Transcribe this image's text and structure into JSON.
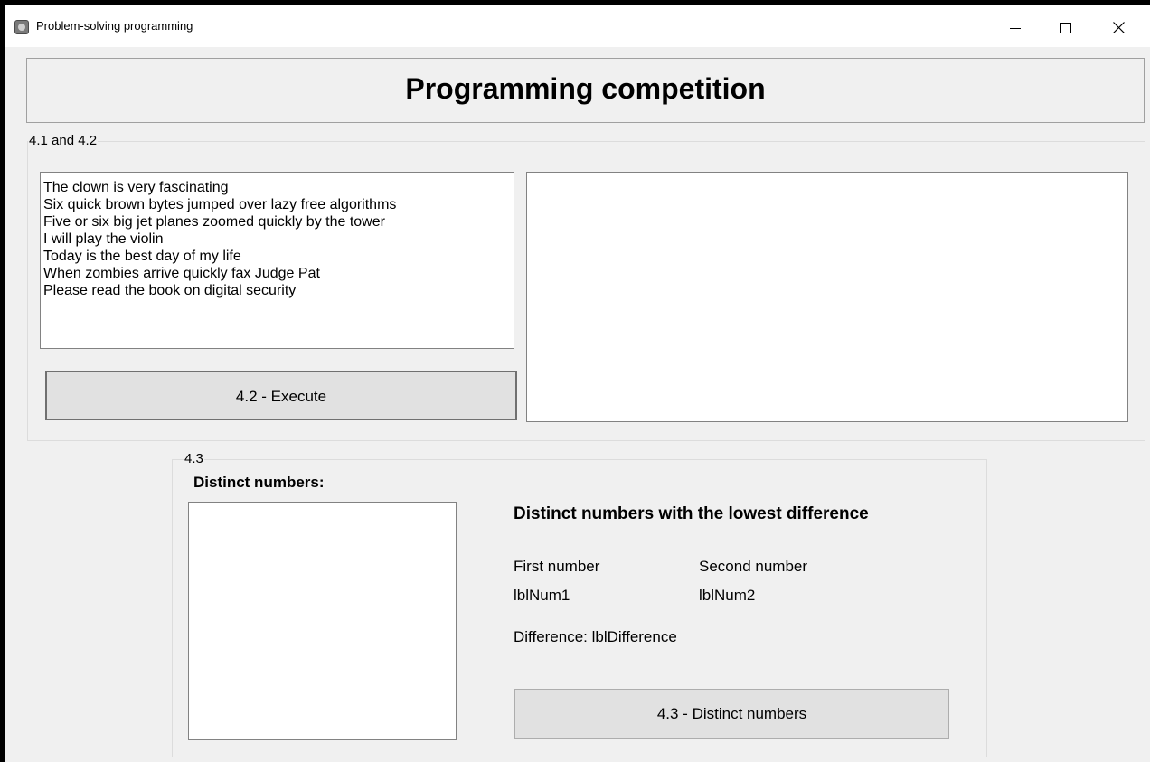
{
  "window": {
    "title": "Problem-solving programming",
    "controls": {
      "minimize": "minimize-icon",
      "maximize": "maximize-icon",
      "close": "close-icon"
    }
  },
  "header": {
    "title": "Programming competition"
  },
  "group_4_1_2": {
    "legend": "4.1 and 4.2",
    "lines": [
      "The clown is very fascinating",
      "Six quick brown bytes jumped over lazy free algorithms",
      "Five or six big jet planes zoomed quickly by the tower",
      "I will play the violin",
      "Today is the best day of my life",
      "When zombies arrive quickly fax Judge Pat",
      "Please read the book on digital security"
    ],
    "execute_button": "4.2 - Execute"
  },
  "group_4_3": {
    "legend": "4.3",
    "distinct_label": "Distinct numbers:",
    "lowest_title": "Distinct numbers with the lowest difference",
    "first_label": "First number",
    "second_label": "Second number",
    "num1": "lblNum1",
    "num2": "lblNum2",
    "difference": "Difference:  lblDifference",
    "distinct_button": "4.3 - Distinct numbers"
  }
}
